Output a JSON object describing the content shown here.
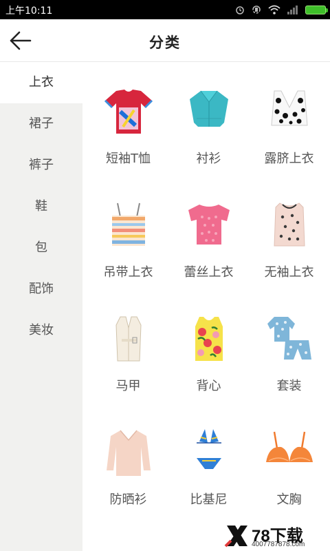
{
  "status_bar": {
    "time": "上午10:11",
    "icons": [
      "alarm-icon",
      "rotate-icon",
      "wifi-icon",
      "signal-icon",
      "battery-icon"
    ],
    "battery_color": "#3fbf2a"
  },
  "header": {
    "back_icon": "arrow-left-icon",
    "title": "分类"
  },
  "sidebar": {
    "items": [
      {
        "label": "上衣",
        "active": true
      },
      {
        "label": "裙子",
        "active": false
      },
      {
        "label": "裤子",
        "active": false
      },
      {
        "label": "鞋",
        "active": false
      },
      {
        "label": "包",
        "active": false
      },
      {
        "label": "配饰",
        "active": false
      },
      {
        "label": "美妆",
        "active": false
      }
    ],
    "background": "#f1f1ef"
  },
  "grid": {
    "items": [
      {
        "label": "短袖T恤",
        "icon": "short-sleeve-tshirt-icon"
      },
      {
        "label": "衬衫",
        "icon": "shirt-icon"
      },
      {
        "label": "露脐上衣",
        "icon": "crop-top-icon"
      },
      {
        "label": "吊带上衣",
        "icon": "camisole-icon"
      },
      {
        "label": "蕾丝上衣",
        "icon": "lace-top-icon"
      },
      {
        "label": "无袖上衣",
        "icon": "sleeveless-top-icon"
      },
      {
        "label": "马甲",
        "icon": "vest-icon"
      },
      {
        "label": "背心",
        "icon": "tank-top-icon"
      },
      {
        "label": "套装",
        "icon": "suit-set-icon"
      },
      {
        "label": "防晒衫",
        "icon": "sun-protection-shirt-icon"
      },
      {
        "label": "比基尼",
        "icon": "bikini-icon"
      },
      {
        "label": "文胸",
        "icon": "bra-icon"
      }
    ]
  },
  "watermark": {
    "brand": "78下载",
    "url": "4007787878.com",
    "logo_icon": "x-logo-icon"
  }
}
